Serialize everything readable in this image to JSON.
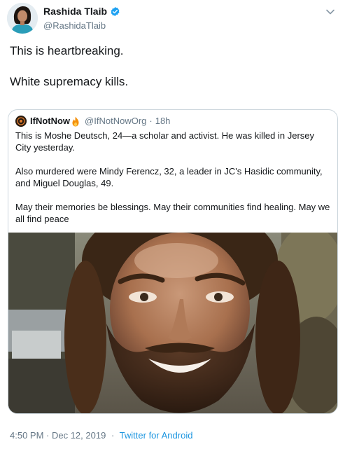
{
  "author": {
    "name": "Rashida Tlaib",
    "handle": "@RashidaTlaib",
    "verified": true
  },
  "icons": {
    "verified": "verified-badge-icon",
    "menu": "chevron-down-icon",
    "flame": "fire-emoji-icon"
  },
  "tweet": {
    "paragraphs": [
      "This is heartbreaking.",
      "White supremacy kills."
    ]
  },
  "quoted": {
    "name": "IfNotNow",
    "handle": "@IfNotNowOrg",
    "separator": "·",
    "time": "18h",
    "paragraphs": [
      "This is Moshe Deutsch, 24—a scholar and activist. He was killed in Jersey City yesterday.",
      "Also murdered were Mindy Ferencz, 32, a leader in JC's Hasidic community, and Miguel Douglas, 49.",
      "May their memories be blessings. May their communities find healing. May we all find peace"
    ]
  },
  "footer": {
    "timestamp": "4:50 PM · Dec 12, 2019",
    "separator": "·",
    "source": "Twitter for Android"
  },
  "colors": {
    "link": "#1b95e0",
    "secondary_text": "#657786",
    "border": "#ccd6dd",
    "verified": "#1da1f2"
  }
}
